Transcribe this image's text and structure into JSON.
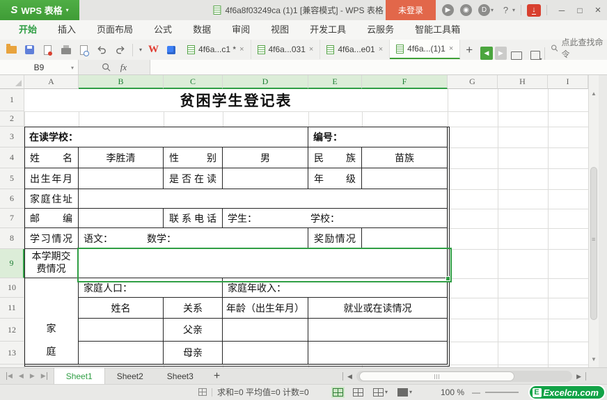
{
  "titlebar": {
    "app_logo": "S",
    "app_button": "WPS 表格",
    "document_title": "4f6a8f03249ca (1)1 [兼容模式] - WPS 表格",
    "login_button": "未登录"
  },
  "icons": {
    "caret": "▾",
    "play": "▶",
    "target": "◉",
    "d_tool": "D",
    "help": "?",
    "download": "↓",
    "minimize": "─",
    "maximize": "□",
    "close": "×",
    "prev": "◀",
    "next": "▶",
    "plus": "+",
    "scroll_up": "▲",
    "scroll_down": "▼",
    "wps_w": "W",
    "fx": "fx",
    "undo": "↶",
    "redo": "↷"
  },
  "menubar": {
    "items": [
      {
        "label": "开始",
        "active": true
      },
      {
        "label": "插入",
        "active": false
      },
      {
        "label": "页面布局",
        "active": false
      },
      {
        "label": "公式",
        "active": false
      },
      {
        "label": "数据",
        "active": false
      },
      {
        "label": "审阅",
        "active": false
      },
      {
        "label": "视图",
        "active": false
      },
      {
        "label": "开发工具",
        "active": false
      },
      {
        "label": "云服务",
        "active": false
      },
      {
        "label": "智能工具箱",
        "active": false
      }
    ]
  },
  "doc_tabs": [
    {
      "label": "4f6a...c1 *",
      "active": false
    },
    {
      "label": "4f6a...031",
      "active": false
    },
    {
      "label": "4f6a...e01",
      "active": false
    },
    {
      "label": "4f6a...(1)1",
      "active": true
    }
  ],
  "find_command": {
    "label": "点此查找命令"
  },
  "formula_bar": {
    "name_box": "B9",
    "fx": "fx",
    "formula": ""
  },
  "sheet": {
    "columns": [
      "A",
      "B",
      "C",
      "D",
      "E",
      "F",
      "G",
      "H",
      "I"
    ],
    "row_numbers": [
      "1",
      "2",
      "3",
      "4",
      "5",
      "6",
      "7",
      "8",
      "9",
      "10",
      "11",
      "12",
      "13"
    ],
    "selection": {
      "ref": "B9",
      "cols": [
        "B",
        "C",
        "D",
        "E",
        "F"
      ],
      "row": "9"
    },
    "cells": [
      {
        "row": 1,
        "col": "A",
        "span": 6,
        "text": "贫困学生登记表",
        "cls": "title"
      },
      {
        "row": 3,
        "col": "A",
        "span": 4,
        "text": "在读学校：",
        "cls": "box left bold"
      },
      {
        "row": 3,
        "col": "E",
        "span": 2,
        "text": "编号：",
        "cls": "box left bold"
      },
      {
        "row": 4,
        "col": "A",
        "span": 1,
        "text": "姓名",
        "cls": "box dist"
      },
      {
        "row": 4,
        "col": "B",
        "span": 1,
        "text": "李胜清",
        "cls": "box center"
      },
      {
        "row": 4,
        "col": "C",
        "span": 1,
        "text": "性别",
        "cls": "box dist"
      },
      {
        "row": 4,
        "col": "D",
        "span": 1,
        "text": "男",
        "cls": "box center"
      },
      {
        "row": 4,
        "col": "E",
        "span": 1,
        "text": "民族",
        "cls": "box dist"
      },
      {
        "row": 4,
        "col": "F",
        "span": 1,
        "text": "苗族",
        "cls": "box center"
      },
      {
        "row": 5,
        "col": "A",
        "span": 1,
        "text": "出生年月",
        "cls": "box dist"
      },
      {
        "row": 5,
        "col": "B",
        "span": 1,
        "text": "",
        "cls": "box"
      },
      {
        "row": 5,
        "col": "C",
        "span": 1,
        "text": "是否在读",
        "cls": "box dist"
      },
      {
        "row": 5,
        "col": "D",
        "span": 1,
        "text": "",
        "cls": "box"
      },
      {
        "row": 5,
        "col": "E",
        "span": 1,
        "text": "年级",
        "cls": "box dist"
      },
      {
        "row": 5,
        "col": "F",
        "span": 1,
        "text": "",
        "cls": "box"
      },
      {
        "row": 6,
        "col": "A",
        "span": 1,
        "text": "家庭住址",
        "cls": "box dist"
      },
      {
        "row": 6,
        "col": "B",
        "span": 5,
        "text": "",
        "cls": "box"
      },
      {
        "row": 7,
        "col": "A",
        "span": 1,
        "text": "邮编",
        "cls": "box dist"
      },
      {
        "row": 7,
        "col": "B",
        "span": 1,
        "text": "",
        "cls": "box"
      },
      {
        "row": 7,
        "col": "C",
        "span": 1,
        "text": "联系电话",
        "cls": "box dist"
      },
      {
        "row": 7,
        "col": "D",
        "span": 3,
        "text": "学生：　　　　　　学校：",
        "cls": "box left pre"
      },
      {
        "row": 8,
        "col": "A",
        "span": 1,
        "text": "学习情况",
        "cls": "box dist"
      },
      {
        "row": 8,
        "col": "B",
        "span": 3,
        "text": "语文：　　　　数学：",
        "cls": "box left pre"
      },
      {
        "row": 8,
        "col": "E",
        "span": 1,
        "text": "奖励情况",
        "cls": "box dist"
      },
      {
        "row": 8,
        "col": "F",
        "span": 1,
        "text": "",
        "cls": "box"
      },
      {
        "row": 9,
        "col": "A",
        "span": 1,
        "text": "本学期交费情况",
        "cls": "box wrap"
      },
      {
        "row": 9,
        "col": "B",
        "span": 5,
        "text": "",
        "cls": "box"
      },
      {
        "row": 10,
        "col": "A",
        "span": 1,
        "rowspan": 4,
        "text": "家\n庭",
        "cls": "box vbottom"
      },
      {
        "row": 10,
        "col": "B",
        "span": 2,
        "text": "家庭人口：",
        "cls": "box left"
      },
      {
        "row": 10,
        "col": "D",
        "span": 3,
        "text": "家庭年收入：",
        "cls": "box left"
      },
      {
        "row": 11,
        "col": "B",
        "span": 1,
        "text": "姓名",
        "cls": "box center"
      },
      {
        "row": 11,
        "col": "C",
        "span": 1,
        "text": "关系",
        "cls": "box center"
      },
      {
        "row": 11,
        "col": "D",
        "span": 1,
        "text": "年龄（出生年月）",
        "cls": "box center"
      },
      {
        "row": 11,
        "col": "E",
        "span": 2,
        "text": "就业或在读情况",
        "cls": "box center"
      },
      {
        "row": 12,
        "col": "B",
        "span": 1,
        "text": "",
        "cls": "box"
      },
      {
        "row": 12,
        "col": "C",
        "span": 1,
        "text": "父亲",
        "cls": "box center"
      },
      {
        "row": 12,
        "col": "D",
        "span": 1,
        "text": "",
        "cls": "box"
      },
      {
        "row": 12,
        "col": "E",
        "span": 2,
        "text": "",
        "cls": "box"
      },
      {
        "row": 13,
        "col": "B",
        "span": 1,
        "text": "",
        "cls": "box"
      },
      {
        "row": 13,
        "col": "C",
        "span": 1,
        "text": "母亲",
        "cls": "box center"
      },
      {
        "row": 13,
        "col": "D",
        "span": 1,
        "text": "",
        "cls": "box"
      },
      {
        "row": 13,
        "col": "E",
        "span": 2,
        "text": "",
        "cls": "box"
      }
    ]
  },
  "sheet_tabs": {
    "tabs": [
      {
        "label": "Sheet1",
        "active": true
      },
      {
        "label": "Sheet2",
        "active": false
      },
      {
        "label": "Sheet3",
        "active": false
      }
    ],
    "add_label": "+"
  },
  "status_bar": {
    "summary": "求和=0  平均值=0  计数=0",
    "zoom_level": "100 %",
    "watermark_e": "E",
    "watermark": "Excelcn.com"
  }
}
